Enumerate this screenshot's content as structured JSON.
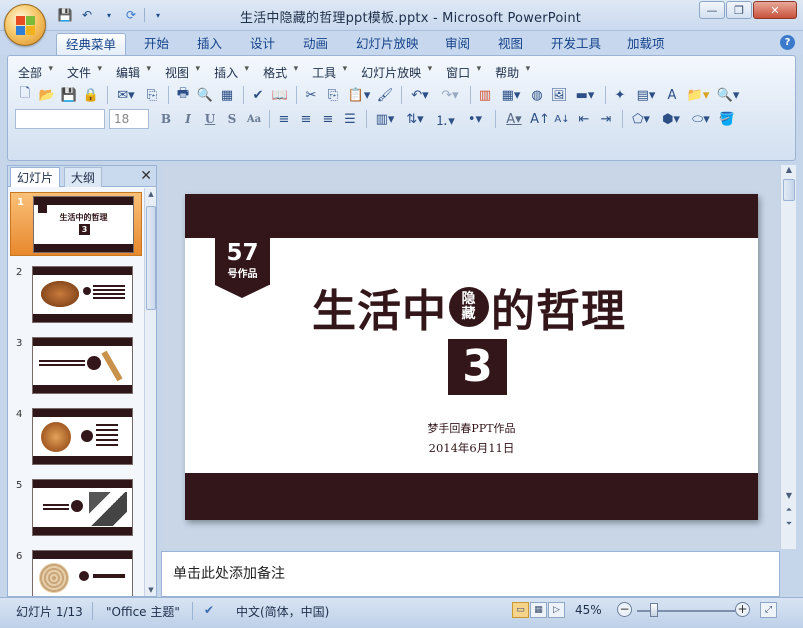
{
  "window": {
    "title": "生活中隐藏的哲理ppt模板.pptx - Microsoft PowerPoint"
  },
  "ribbon_tabs": [
    "经典菜单",
    "开始",
    "插入",
    "设计",
    "动画",
    "幻灯片放映",
    "审阅",
    "视图",
    "开发工具",
    "加载项"
  ],
  "menus": [
    "全部",
    "文件",
    "编辑",
    "视图",
    "插入",
    "格式",
    "工具",
    "幻灯片放映",
    "窗口",
    "帮助"
  ],
  "font_size_value": "18",
  "left_pane": {
    "tab_slides": "幻灯片",
    "tab_outline": "大纲"
  },
  "slide": {
    "badge_num": "57",
    "badge_sub": "号作品",
    "title_part1": "生活中",
    "title_inset_top": "隐",
    "title_inset_bottom": "藏",
    "title_part2": "的哲理",
    "number": "3",
    "author": "梦手回春PPT作品",
    "date": "2014年6月11日"
  },
  "thumb_numbers": [
    "1",
    "2",
    "3",
    "4",
    "5",
    "6"
  ],
  "thumb1_title": "生活中的哲理",
  "thumb1_num": "3",
  "notes_placeholder": "单击此处添加备注",
  "status": {
    "slide_info": "幻灯片 1/13",
    "theme": "\"Office 主题\"",
    "language": "中文(简体，中国)",
    "zoom": "45%"
  },
  "colors": {
    "slide_brown": "#321619",
    "accent_orange": "#e8882d"
  }
}
